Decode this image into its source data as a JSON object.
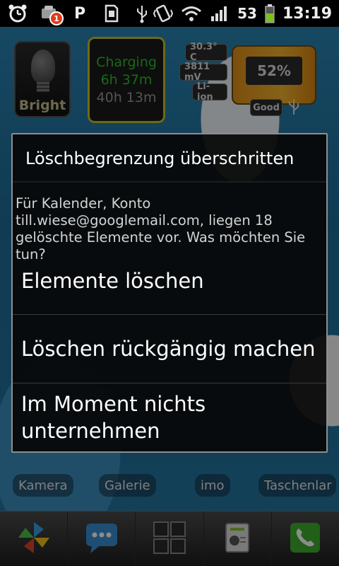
{
  "status_bar": {
    "icons": [
      "alarm-clock-icon",
      "android-notification-icon",
      "parking-icon",
      "sd-card-icon",
      "usb-icon",
      "vibrate-icon",
      "wifi-icon",
      "signal-icon",
      "battery-icon"
    ],
    "notification_count": "1",
    "p_label": "P",
    "battery_text": "53",
    "time": "13:19"
  },
  "home_widgets": {
    "bulb_label": "Bright",
    "charging_title": "Charging",
    "charging_time": "6h 37m",
    "remaining_time": "40h 13m",
    "temperature": "30.3° C",
    "voltage": "3811 mV",
    "battery_type": "Li-ion",
    "battery_percent": "52%",
    "health": "Good"
  },
  "home_labels": [
    "Kamera",
    "Galerie",
    "imo",
    "Taschenlar"
  ],
  "dock": {
    "icons": [
      "pinwheel-icon",
      "messaging-icon",
      "app-drawer-icon",
      "task-manager-icon",
      "phone-icon"
    ]
  },
  "dialog": {
    "title": "Löschbegrenzung überschritten",
    "message": "Für Kalender, Konto till.wiese@googlemail.com, liegen 18 gelöschte Elemente vor. Was möchten Sie tun?",
    "options": [
      "Elemente löschen",
      "Löschen rückgängig machen",
      "Im Moment nichts unternehmen"
    ]
  },
  "colors": {
    "charging_green": "#2fbf2f",
    "charge_border": "#c6c12c",
    "dialog_bg": "#080808",
    "dialog_border": "#8e8e8e"
  }
}
